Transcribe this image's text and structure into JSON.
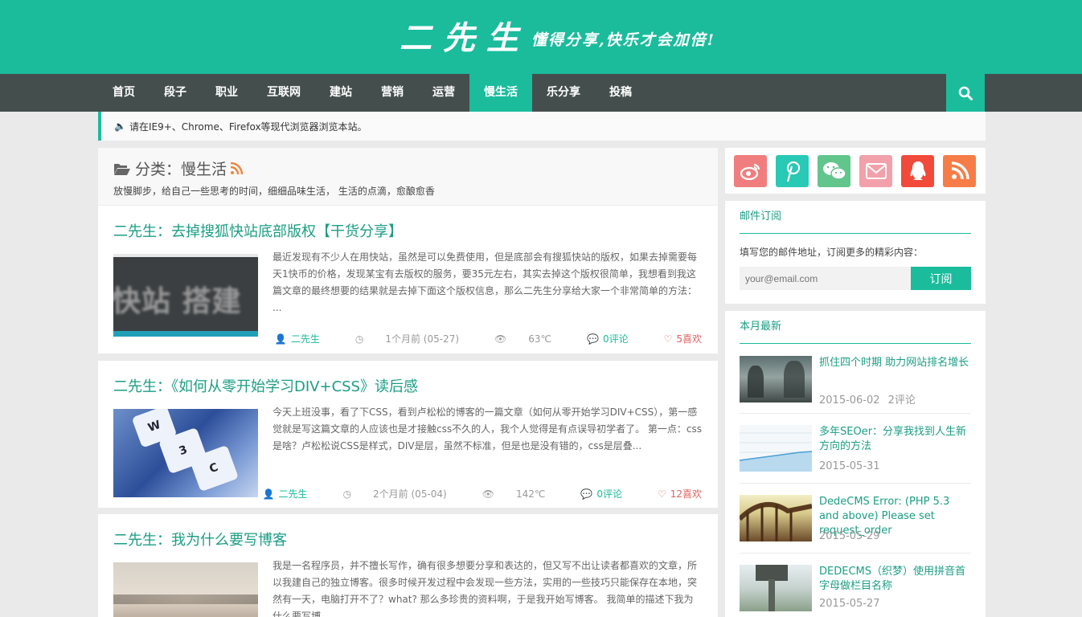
{
  "header": {
    "logo_main": "二先生",
    "logo_sub": "懂得分享,快乐才会加倍!"
  },
  "nav": {
    "items": [
      {
        "label": "首页",
        "active": false
      },
      {
        "label": "段子",
        "active": false
      },
      {
        "label": "职业",
        "active": false
      },
      {
        "label": "互联网",
        "active": false
      },
      {
        "label": "建站",
        "active": false
      },
      {
        "label": "营销",
        "active": false
      },
      {
        "label": "运营",
        "active": false
      },
      {
        "label": "慢生活",
        "active": true
      },
      {
        "label": "乐分享",
        "active": false
      },
      {
        "label": "投稿",
        "active": false
      }
    ],
    "search_icon": "search-icon"
  },
  "notice": {
    "text": "请在IE9+、Chrome、Firefox等现代浏览器浏览本站。"
  },
  "category": {
    "title": "分类：慢生活",
    "desc": "放慢脚步，给自己一些思考的时间，细细品味生活， 生活的点滴，愈酿愈香"
  },
  "posts": [
    {
      "title": "二先生：去掉搜狐快站底部版权【干货分享】",
      "excerpt": "最近发现有不少人在用快站，虽然是可以免费使用，但是底部会有搜狐快站的版权，如果去掉需要每天1快币的价格，发现某宝有去版权的服务，要35元左右，其实去掉这个版权很简单，我想看到我这篇文章的最终想要的结果就是去掉下面这个版权信息，那么二先生分享给大家一个非常简单的方法：  ...",
      "author": "二先生",
      "time": "1个月前 (05-27)",
      "views": "63℃",
      "comments": "0评论",
      "likes": "5喜欢",
      "thumb_text": "快站 搭建"
    },
    {
      "title": "二先生：《如何从零开始学习DIV+CSS》读后感",
      "excerpt": "今天上班没事，看了下CSS，看到卢松松的博客的一篇文章（如何从零开始学习DIV+CSS），第一感觉就是写这篇文章的人应该也是才接触css不久的人，我个人觉得是有点误导初学者了。 第一点：css是啥？卢松松说CSS是样式，DIV是层，虽然不标准，但是也是没有错的，css是层叠...",
      "author": "二先生",
      "time": "2个月前 (05-04)",
      "views": "142℃",
      "comments": "0评论",
      "likes": "12喜欢",
      "keys": [
        "W",
        "3",
        "C"
      ]
    },
    {
      "title": "二先生：我为什么要写博客",
      "excerpt": "我是一名程序员，并不擅长写作，确有很多想要分享和表达的，但又写不出让读者都喜欢的文章，所以我建自己的独立博客。很多时候开发过程中会发现一些方法，实用的一些技巧只能保存在本地，突然有一天，电脑打开不了？what? 那么多珍贵的资料啊，于是我开始写博客。 我简单的描述下我为什么要写博"
    }
  ],
  "sidebar": {
    "social": [
      {
        "icon": "weibo-icon",
        "color": "#f07e7e"
      },
      {
        "icon": "pinterest-icon",
        "color": "#28c9b5"
      },
      {
        "icon": "wechat-icon",
        "color": "#62c58c"
      },
      {
        "icon": "mail-icon",
        "color": "#f2a1ab"
      },
      {
        "icon": "qq-icon",
        "color": "#f24a3a"
      },
      {
        "icon": "rss-icon",
        "color": "#f67d47"
      }
    ],
    "mail": {
      "title": "邮件订阅",
      "desc": "填写您的邮件地址，订阅更多的精彩内容：",
      "placeholder": "your@email.com",
      "button": "订阅"
    },
    "latest": {
      "title": "本月最新",
      "items": [
        {
          "title": "抓住四个时期 助力网站排名增长",
          "date": "2015-06-02",
          "comments": "2评论"
        },
        {
          "title": "多年SEOer：分享我找到人生新方向的方法",
          "date": "2015-05-31"
        },
        {
          "title": "DedeCMS Error: (PHP 5.3 and above) Please set request_order",
          "date": "2015-05-29"
        },
        {
          "title": "DEDECMS（织梦）使用拼音首字母做栏目名称",
          "date": "2015-05-27"
        }
      ]
    }
  }
}
